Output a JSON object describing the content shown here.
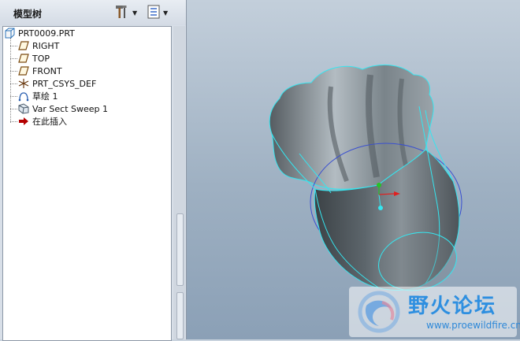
{
  "panel": {
    "title": "模型树"
  },
  "tree": {
    "items": [
      {
        "label": "PRT0009.PRT",
        "icon": "part-icon"
      },
      {
        "label": "RIGHT",
        "icon": "datum-plane-icon"
      },
      {
        "label": "TOP",
        "icon": "datum-plane-icon"
      },
      {
        "label": "FRONT",
        "icon": "datum-plane-icon"
      },
      {
        "label": "PRT_CSYS_DEF",
        "icon": "coordinate-system-icon"
      },
      {
        "label": "草绘 1",
        "icon": "sketch-icon"
      },
      {
        "label": "Var Sect Sweep 1",
        "icon": "sweep-feature-icon"
      },
      {
        "label": "在此插入",
        "icon": "insert-here-arrow-icon"
      }
    ]
  },
  "watermark": {
    "title": "野火论坛",
    "url": "www.proewildfire.cn"
  },
  "colors": {
    "model_edge": "#35e6f0",
    "sketch_curve": "#3a50d0",
    "insert_arrow": "#b40000",
    "csys_green": "#27c227",
    "csys_red": "#e02020"
  }
}
